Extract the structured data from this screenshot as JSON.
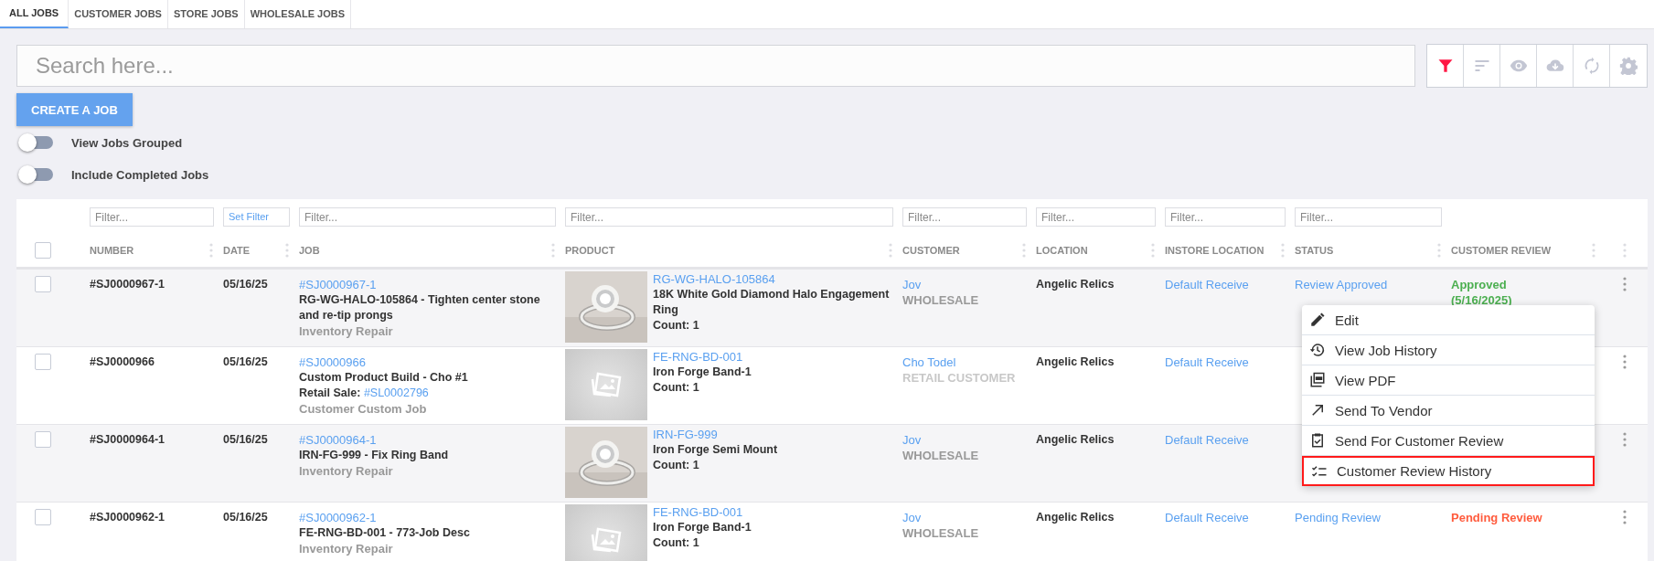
{
  "tabs": [
    {
      "label": "ALL JOBS",
      "selected": true
    },
    {
      "label": "CUSTOMER JOBS",
      "selected": false
    },
    {
      "label": "STORE JOBS",
      "selected": false
    },
    {
      "label": "WHOLESALE JOBS",
      "selected": false
    }
  ],
  "search": {
    "placeholder": "Search here..."
  },
  "toolbar": [
    {
      "kind": "filter",
      "active": true
    },
    {
      "kind": "sort",
      "active": false
    },
    {
      "kind": "view",
      "active": false
    },
    {
      "kind": "download",
      "active": false
    },
    {
      "kind": "refresh",
      "active": false
    },
    {
      "kind": "settings",
      "active": false
    }
  ],
  "create_button": "CREATE A JOB",
  "toggles": [
    {
      "label": "View Jobs Grouped",
      "on": false
    },
    {
      "label": "Include Completed Jobs",
      "on": false
    }
  ],
  "table": {
    "select_all": {
      "checked": false
    },
    "columns": [
      {
        "label": "NUMBER",
        "filter": {
          "kind": "text",
          "placeholder": "Filter..."
        }
      },
      {
        "label": "DATE",
        "filter": {
          "kind": "set",
          "label": "Set Filter"
        }
      },
      {
        "label": "JOB",
        "filter": {
          "kind": "text",
          "placeholder": "Filter..."
        }
      },
      {
        "label": "PRODUCT",
        "filter": {
          "kind": "text",
          "placeholder": "Filter..."
        }
      },
      {
        "label": "CUSTOMER",
        "filter": {
          "kind": "text",
          "placeholder": "Filter..."
        }
      },
      {
        "label": "LOCATION",
        "filter": {
          "kind": "text",
          "placeholder": "Filter..."
        }
      },
      {
        "label": "INSTORE LOCATION",
        "filter": {
          "kind": "text",
          "placeholder": "Filter..."
        }
      },
      {
        "label": "STATUS",
        "filter": {
          "kind": "text",
          "placeholder": "Filter..."
        }
      },
      {
        "label": "CUSTOMER REVIEW"
      }
    ],
    "rows": [
      {
        "checked": false,
        "number": "#SJ0000967-1",
        "date": "05/16/25",
        "job": {
          "id": "#SJ0000967-1",
          "description": "RG-WG-HALO-105864 - Tighten center stone and re-tip prongs",
          "type": "Inventory Repair"
        },
        "product": {
          "kind": "picture",
          "sku": "RG-WG-HALO-105864",
          "name": "18K White Gold Diamond Halo Engagement Ring",
          "count": "Count: 1"
        },
        "customer": {
          "name": "Jov",
          "type": "WHOLESALE",
          "color": "#999999"
        },
        "location": "Angelic Relics",
        "instore_location": "Default Receive",
        "status": [
          "Review Approved"
        ],
        "review": {
          "lines": [
            "Approved",
            "(5/16/2025)"
          ],
          "color": "#4caf50"
        }
      },
      {
        "checked": false,
        "number": "#SJ0000966",
        "date": "05/16/25",
        "job": {
          "id": "#SJ0000966",
          "description": "Custom Product Build - Cho #1",
          "retail_sale": {
            "label": "Retail Sale:",
            "id": "#SL0002796"
          },
          "type": "Customer Custom Job"
        },
        "product": {
          "kind": "placeholder",
          "sku": "FE-RNG-BD-001",
          "name": "Iron Forge Band-1",
          "count": "Count: 1"
        },
        "customer": {
          "name": "Cho Todel",
          "type": "RETAIL CUSTOMER",
          "color": "#c8c8c8"
        },
        "location": "Angelic Relics",
        "instore_location": "Default Receive"
      },
      {
        "checked": false,
        "number": "#SJ0000964-1",
        "date": "05/16/25",
        "job": {
          "id": "#SJ0000964-1",
          "description": "IRN-FG-999 - Fix Ring Band",
          "type": "Inventory Repair"
        },
        "product": {
          "kind": "picture",
          "sku": "IRN-FG-999",
          "name": "Iron Forge Semi Mount",
          "count": "Count: 1"
        },
        "customer": {
          "name": "Jov",
          "type": "WHOLESALE",
          "color": "#999999"
        },
        "location": "Angelic Relics",
        "instore_location": "Default Receive"
      },
      {
        "checked": false,
        "number": "#SJ0000962-1",
        "date": "05/16/25",
        "job": {
          "id": "#SJ0000962-1",
          "description": "FE-RNG-BD-001 - 773-Job Desc",
          "type": "Inventory Repair"
        },
        "product": {
          "kind": "placeholder",
          "sku": "FE-RNG-BD-001",
          "name": "Iron Forge Band-1",
          "count": "Count: 1"
        },
        "customer": {
          "name": "Jov",
          "type": "WHOLESALE",
          "color": "#999999"
        },
        "location": "Angelic Relics",
        "instore_location": "Default Receive",
        "status": [
          "Pending Review"
        ],
        "review": {
          "lines": [
            "Pending Review"
          ],
          "color": "#ff5b3d"
        }
      }
    ]
  },
  "context_menu": {
    "items": [
      {
        "kind": "edit",
        "label": "Edit",
        "selected": false
      },
      {
        "kind": "history",
        "label": "View Job History",
        "selected": false
      },
      {
        "kind": "pdf",
        "label": "View PDF",
        "selected": false
      },
      {
        "kind": "send",
        "label": "Send To Vendor",
        "selected": false
      },
      {
        "kind": "review",
        "label": "Send For Customer Review",
        "selected": false
      },
      {
        "kind": "checklist",
        "label": "Customer Review History",
        "selected": true
      }
    ]
  }
}
